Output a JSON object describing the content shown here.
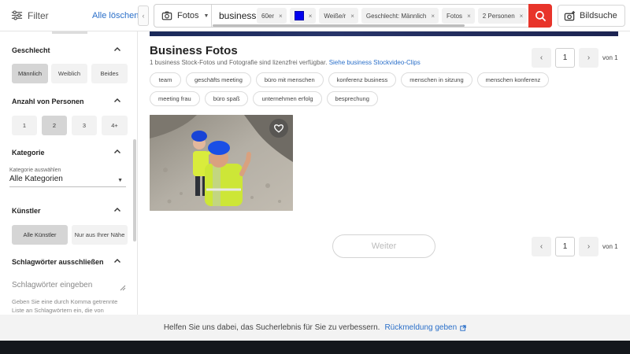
{
  "top": {
    "filter_label": "Filter",
    "clear_all": "Alle löschen",
    "collapse_icon": "chevron-left-icon",
    "media_type": "Fotos",
    "query": "business",
    "chips": [
      {
        "label": "60er"
      },
      {
        "label": "",
        "swatch": "#0000ee"
      },
      {
        "label": "Weiße/r"
      },
      {
        "label": "Geschlecht: Männlich"
      },
      {
        "label": "Fotos"
      },
      {
        "label": "2 Personen"
      }
    ],
    "chip_close": "×",
    "search_color": "#e8342a",
    "image_search": "Bildsuche"
  },
  "sidebar": {
    "gender": {
      "title": "Geschlecht",
      "options": [
        {
          "label": "Männlich",
          "active": true
        },
        {
          "label": "Weiblich",
          "active": false
        },
        {
          "label": "Beides",
          "active": false
        }
      ]
    },
    "people": {
      "title": "Anzahl von Personen",
      "options": [
        {
          "label": "1",
          "active": false
        },
        {
          "label": "2",
          "active": true
        },
        {
          "label": "3",
          "active": false
        },
        {
          "label": "4+",
          "active": false
        }
      ]
    },
    "category": {
      "title": "Kategorie",
      "label": "Kategorie auswählen",
      "value": "Alle Kategorien"
    },
    "artist": {
      "title": "Künstler",
      "options": [
        {
          "label": "Alle Künstler",
          "active": true
        },
        {
          "label": "Nur aus Ihrer Nähe",
          "active": false
        }
      ]
    },
    "exclude": {
      "title": "Schlagwörter ausschließen",
      "placeholder": "Schlagwörter eingeben",
      "help": "Geben Sie eine durch Komma getrennte Liste an Schlagwörtern ein, die von"
    }
  },
  "main": {
    "title": "Business Fotos",
    "subtitle": "1 business Stock-Fotos und Fotografie sind lizenzfrei verfügbar.",
    "video_link": "Siehe business Stockvideo-Clips",
    "page": "1",
    "of_label": "von 1",
    "tags": [
      "team",
      "geschäfts meeting",
      "büro mit menschen",
      "konferenz business",
      "menschen in sitzung",
      "menschen konferenz",
      "meeting frau",
      "büro spaß",
      "unternehmen erfolg",
      "besprechung"
    ],
    "next": "Weiter"
  },
  "footer": {
    "text": "Helfen Sie uns dabei, das Sucherlebnis für Sie zu verbessern.",
    "link": "Rückmeldung geben"
  }
}
